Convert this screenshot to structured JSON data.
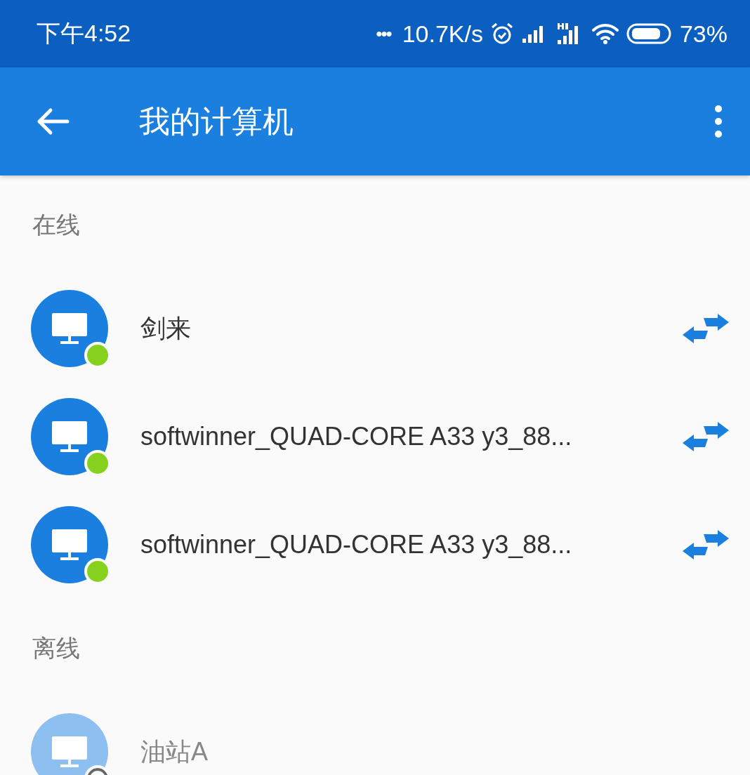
{
  "status_bar": {
    "time": "下午4:52",
    "dots": "•••",
    "speed": "10.7K/s",
    "battery": "73%"
  },
  "app_bar": {
    "title": "我的计算机"
  },
  "sections": [
    {
      "title": "在线",
      "devices": [
        {
          "name": "剑来",
          "online": true
        },
        {
          "name": "softwinner_QUAD-CORE A33 y3_88...",
          "online": true
        },
        {
          "name": "softwinner_QUAD-CORE A33 y3_88...",
          "online": true
        }
      ]
    },
    {
      "title": "离线",
      "devices": [
        {
          "name": "油站A",
          "online": false
        }
      ]
    }
  ]
}
